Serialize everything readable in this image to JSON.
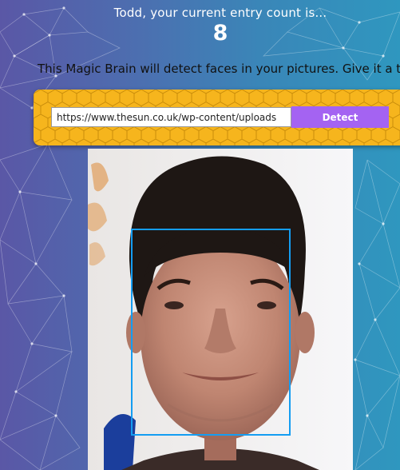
{
  "header": {
    "greeting": "Todd, your current entry count is...",
    "entry_count": "8"
  },
  "intro_text": "This Magic Brain will detect faces in your pictures. Give it a try.",
  "form": {
    "url_value": "https://www.thesun.co.uk/wp-content/uploads",
    "detect_label": "Detect"
  },
  "colors": {
    "panel": "#f6b51d",
    "button": "#a463f2",
    "face_box": "#149df2"
  },
  "result": {
    "faces_detected": 1
  }
}
